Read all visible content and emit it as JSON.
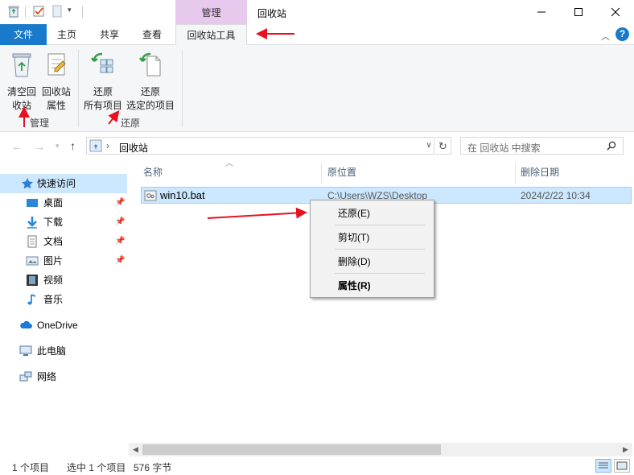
{
  "window": {
    "context_tab_header": "管理",
    "title": "回收站",
    "icons": {
      "app": "recycle-bin-icon",
      "minimize": "minimize-icon",
      "maximize": "maximize-icon",
      "close": "close-icon"
    }
  },
  "ribbon": {
    "tabs": [
      {
        "label": "文件"
      },
      {
        "label": "主页"
      },
      {
        "label": "共享"
      },
      {
        "label": "查看"
      },
      {
        "label": "回收站工具"
      }
    ],
    "groups": [
      {
        "label": "管理",
        "buttons": [
          {
            "line1": "清空回",
            "line2": "收站",
            "icon": "empty-recycle-bin-icon"
          },
          {
            "line1": "回收站",
            "line2": "属性",
            "icon": "properties-icon"
          }
        ]
      },
      {
        "label": "还原",
        "buttons": [
          {
            "line1": "还原",
            "line2": "所有项目",
            "icon": "restore-all-icon"
          },
          {
            "line1": "还原",
            "line2": "选定的项目",
            "icon": "restore-selected-icon"
          }
        ]
      }
    ],
    "help_label": "?"
  },
  "address": {
    "path": "回收站",
    "breadcrumb_arrow": "›",
    "search_placeholder": "在 回收站 中搜索"
  },
  "nav": {
    "quick_access": "快速访问",
    "pinned": [
      {
        "label": "桌面",
        "icon": "desktop-icon",
        "pinned": true
      },
      {
        "label": "下载",
        "icon": "download-icon",
        "pinned": true
      },
      {
        "label": "文档",
        "icon": "documents-icon",
        "pinned": true
      },
      {
        "label": "图片",
        "icon": "pictures-icon",
        "pinned": true
      },
      {
        "label": "视频",
        "icon": "videos-icon",
        "pinned": false
      },
      {
        "label": "音乐",
        "icon": "music-icon",
        "pinned": false
      }
    ],
    "onedrive": "OneDrive",
    "this_pc": "此电脑",
    "network": "网络"
  },
  "filelist": {
    "columns": [
      "名称",
      "原位置",
      "删除日期"
    ],
    "rows": [
      {
        "name": "win10.bat",
        "location": "C:\\Users\\WZS\\Desktop",
        "deleted": "2024/2/22 10:34"
      }
    ]
  },
  "context_menu": {
    "items": [
      {
        "label": "还原(E)",
        "bold": false
      },
      {
        "label": "剪切(T)",
        "bold": false
      },
      {
        "label": "删除(D)",
        "bold": false
      },
      {
        "label": "属性(R)",
        "bold": true
      }
    ]
  },
  "status": {
    "item_count": "1 个项目",
    "selected": "选中 1 个项目",
    "size": "576 字节"
  },
  "colors": {
    "accent": "#1979ca",
    "selection": "#cce8ff",
    "context_tab": "#e8c9ee",
    "annotation": "#e81123"
  }
}
